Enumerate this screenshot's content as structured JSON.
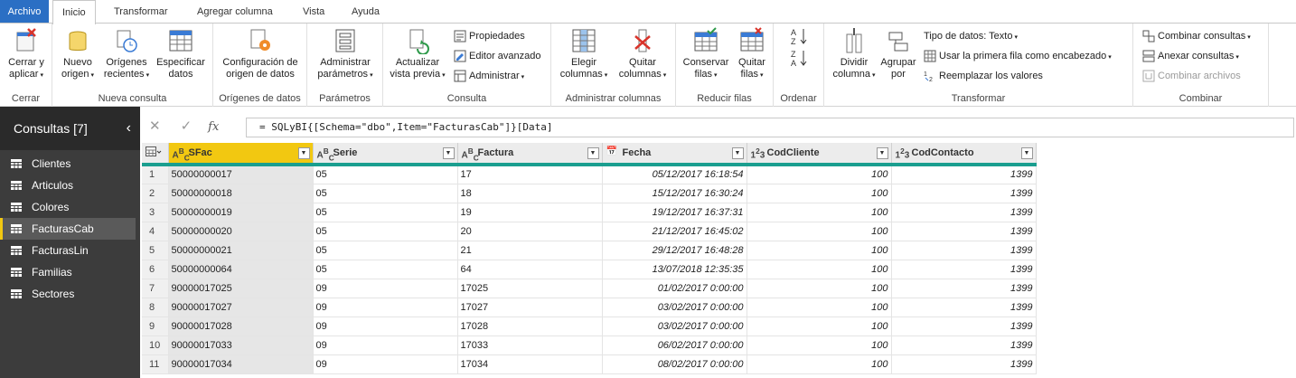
{
  "tabs": [
    "Archivo",
    "Inicio",
    "Transformar",
    "Agregar columna",
    "Vista",
    "Ayuda"
  ],
  "ribbon": {
    "cerrar": {
      "btn": "Cerrar y",
      "btn2": "aplicar",
      "label": "Cerrar"
    },
    "nueva_consulta": {
      "nuevo": "Nuevo",
      "nuevo2": "origen",
      "origenes": "Orígenes",
      "origenes2": "recientes",
      "especificar": "Especificar",
      "especificar2": "datos",
      "label": "Nueva consulta"
    },
    "origenes_datos": {
      "btn": "Configuración de",
      "btn2": "origen de datos",
      "label": "Orígenes de datos"
    },
    "parametros": {
      "btn": "Administrar",
      "btn2": "parámetros",
      "label": "Parámetros"
    },
    "consulta": {
      "actualizar": "Actualizar",
      "actualizar2": "vista previa",
      "propiedades": "Propiedades",
      "editor": "Editor avanzado",
      "administrar": "Administrar",
      "label": "Consulta"
    },
    "admin_columnas": {
      "elegir": "Elegir",
      "elegir2": "columnas",
      "quitar": "Quitar",
      "quitar2": "columnas",
      "label": "Administrar columnas"
    },
    "reducir": {
      "conservar": "Conservar",
      "conservar2": "filas",
      "quitar": "Quitar",
      "quitar2": "filas",
      "label": "Reducir filas"
    },
    "ordenar": {
      "label": "Ordenar"
    },
    "transformar": {
      "dividir": "Dividir",
      "dividir2": "columna",
      "agrupar": "Agrupar",
      "agrupar2": "por",
      "tipo": "Tipo de datos: Texto",
      "primera": "Usar la primera fila como encabezado",
      "reemplazar": "Reemplazar los valores",
      "label": "Transformar"
    },
    "combinar": {
      "combinar_consultas": "Combinar consultas",
      "anexar": "Anexar consultas",
      "combinar_archivos": "Combinar archivos",
      "label": "Combinar"
    }
  },
  "sidebar": {
    "title": "Consultas [7]",
    "items": [
      "Clientes",
      "Articulos",
      "Colores",
      "FacturasCab",
      "FacturasLin",
      "Familias",
      "Sectores"
    ]
  },
  "formula": "= SQLyBI{[Schema=\"dbo\",Item=\"FacturasCab\"]}[Data]",
  "grid": {
    "columns": [
      {
        "name": "SFac",
        "type": "ABC"
      },
      {
        "name": "Serie",
        "type": "ABC"
      },
      {
        "name": "Factura",
        "type": "ABC"
      },
      {
        "name": "Fecha",
        "type": "date"
      },
      {
        "name": "CodCliente",
        "type": "123"
      },
      {
        "name": "CodContacto",
        "type": "123"
      }
    ],
    "rows": [
      [
        "1",
        "50000000017",
        "05",
        "17",
        "05/12/2017 16:18:54",
        "100",
        "1399"
      ],
      [
        "2",
        "50000000018",
        "05",
        "18",
        "15/12/2017 16:30:24",
        "100",
        "1399"
      ],
      [
        "3",
        "50000000019",
        "05",
        "19",
        "19/12/2017 16:37:31",
        "100",
        "1399"
      ],
      [
        "4",
        "50000000020",
        "05",
        "20",
        "21/12/2017 16:45:02",
        "100",
        "1399"
      ],
      [
        "5",
        "50000000021",
        "05",
        "21",
        "29/12/2017 16:48:28",
        "100",
        "1399"
      ],
      [
        "6",
        "50000000064",
        "05",
        "64",
        "13/07/2018 12:35:35",
        "100",
        "1399"
      ],
      [
        "7",
        "90000017025",
        "09",
        "17025",
        "01/02/2017 0:00:00",
        "100",
        "1399"
      ],
      [
        "8",
        "90000017027",
        "09",
        "17027",
        "03/02/2017 0:00:00",
        "100",
        "1399"
      ],
      [
        "9",
        "90000017028",
        "09",
        "17028",
        "03/02/2017 0:00:00",
        "100",
        "1399"
      ],
      [
        "10",
        "90000017033",
        "09",
        "17033",
        "06/02/2017 0:00:00",
        "100",
        "1399"
      ],
      [
        "11",
        "90000017034",
        "09",
        "17034",
        "08/02/2017 0:00:00",
        "100",
        "1399"
      ]
    ]
  },
  "colors": {
    "accent": "#2b6fc4",
    "selected_column": "#f2c811",
    "header_underline": "#1a9e8f",
    "sidebar_bg": "#3c3c3c"
  }
}
